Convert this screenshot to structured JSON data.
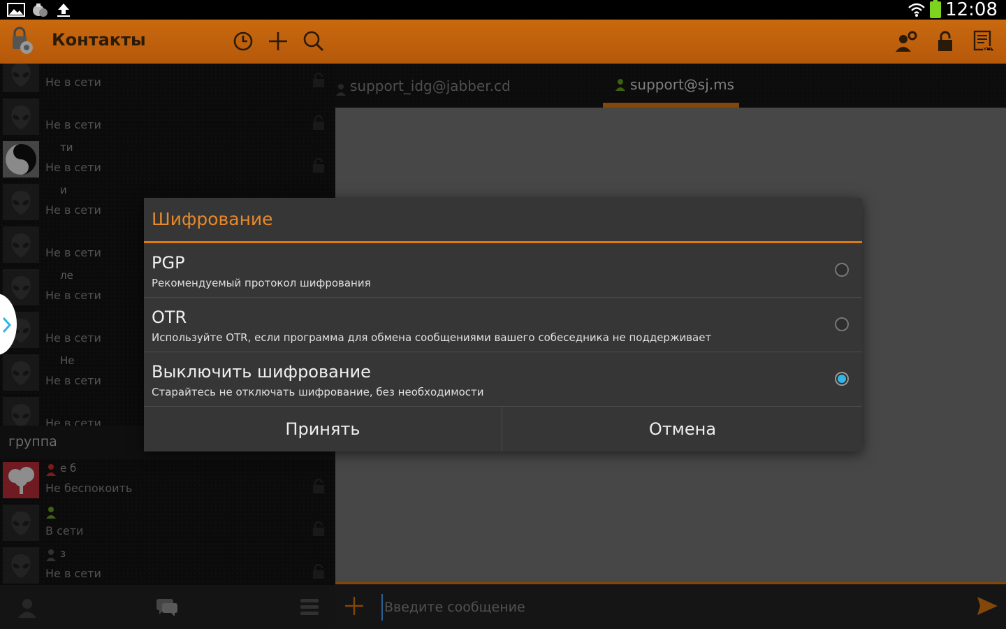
{
  "statusbar": {
    "time": "12:08",
    "icons": [
      "gallery-icon",
      "app-notification-icon",
      "upload-icon",
      "wifi-icon",
      "battery-icon"
    ]
  },
  "actionbar": {
    "title": "Контакты",
    "left_icons": [
      "history-icon",
      "add-icon",
      "search-icon"
    ],
    "right_icons": [
      "account-settings-icon",
      "lock-icon",
      "xml-console-icon"
    ]
  },
  "contacts": {
    "items": [
      {
        "name": "",
        "status": "Не в сети",
        "avatar": "alien-avatar"
      },
      {
        "name": "",
        "status": "Не в сети",
        "avatar": "alien-avatar"
      },
      {
        "name": "ти",
        "status": "Не в сети",
        "avatar": "yin-yang-avatar"
      },
      {
        "name": "и",
        "status": "Не в сети",
        "avatar": "alien-avatar"
      },
      {
        "name": "",
        "status": "Не в сети",
        "avatar": "alien-avatar"
      },
      {
        "name": "ле",
        "status": "Не в сети",
        "avatar": "alien-avatar"
      },
      {
        "name": "",
        "status": "Не в сети",
        "avatar": "alien-avatar"
      },
      {
        "name": "Не",
        "status": "Не в сети",
        "avatar": "alien-avatar"
      },
      {
        "name": "",
        "status": "Не в сети",
        "avatar": "alien-avatar"
      }
    ],
    "group_label": "группа",
    "group_items": [
      {
        "name": "е б",
        "status": "Не беспокоить",
        "avatar": "tree-avatar",
        "presence_color": "#d0302a"
      },
      {
        "name": "",
        "status": "В сети",
        "avatar": "alien-avatar",
        "presence_color": "#6aa51e"
      },
      {
        "name": "з",
        "status": "Не в сети",
        "avatar": "alien-avatar",
        "presence_color": "#555555"
      }
    ]
  },
  "bottom_nav": [
    "contacts-icon",
    "chats-icon",
    "menu-list-icon"
  ],
  "tabs": [
    {
      "label": "support_idg@jabber.cd",
      "active": false
    },
    {
      "label": "support@sj.ms",
      "active": true
    }
  ],
  "input": {
    "placeholder": "Введите сообщение"
  },
  "dialog": {
    "title": "Шифрование",
    "options": [
      {
        "title": "PGP",
        "description": "Рекомендуемый протокол шифрования",
        "selected": false
      },
      {
        "title": "OTR",
        "description": "Используйте OTR, если программа для обмена сообщениями вашего собеседника не поддерживает",
        "selected": false
      },
      {
        "title": "Выключить шифрование",
        "description": "Старайтесь не отключать шифрование, без необходимости",
        "selected": true
      }
    ],
    "accept_label": "Принять",
    "cancel_label": "Отмена"
  },
  "colors": {
    "accent": "#e07a10",
    "actionbar": "#c0600a",
    "radio_selected": "#33b5e5"
  }
}
